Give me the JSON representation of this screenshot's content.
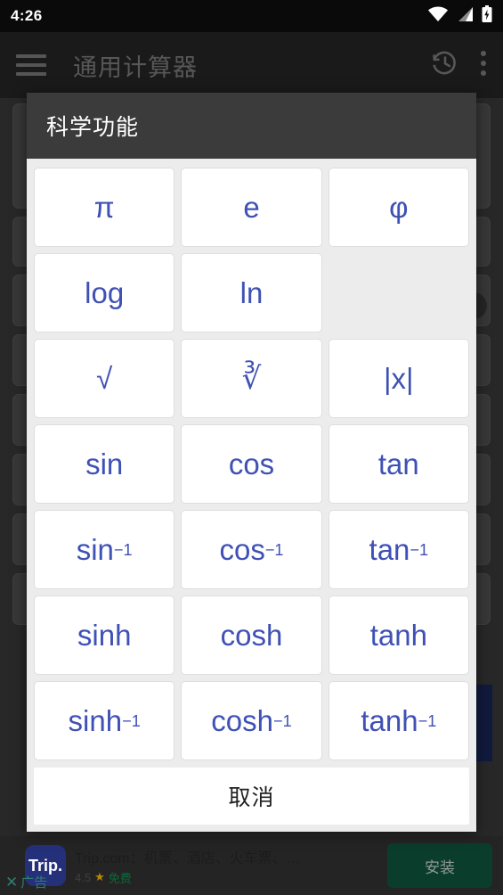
{
  "status_bar": {
    "time": "4:26",
    "icons": [
      "wifi-icon",
      "cellular-signal-icon",
      "battery-charging-icon"
    ]
  },
  "app_bar": {
    "menu_icon": "hamburger-menu-icon",
    "title": "通用计算器",
    "history_icon": "history-clock-icon",
    "overflow_icon": "more-vertical-icon"
  },
  "dialog": {
    "title": "科学功能",
    "buttons": [
      {
        "label": "π",
        "type": "plain"
      },
      {
        "label": "e",
        "type": "plain"
      },
      {
        "label": "φ",
        "type": "plain"
      },
      {
        "label": "log",
        "type": "plain"
      },
      {
        "label": "ln",
        "type": "plain"
      },
      {
        "label": "",
        "type": "empty"
      },
      {
        "label": "√",
        "type": "plain"
      },
      {
        "label": "∛",
        "type": "cbrt"
      },
      {
        "label": "|x|",
        "type": "plain"
      },
      {
        "label": "sin",
        "type": "plain"
      },
      {
        "label": "cos",
        "type": "plain"
      },
      {
        "label": "tan",
        "type": "plain"
      },
      {
        "base": "sin",
        "sup": "−1",
        "type": "sup"
      },
      {
        "base": "cos",
        "sup": "−1",
        "type": "sup"
      },
      {
        "base": "tan",
        "sup": "−1",
        "type": "sup"
      },
      {
        "label": "sinh",
        "type": "plain"
      },
      {
        "label": "cosh",
        "type": "plain"
      },
      {
        "label": "tanh",
        "type": "plain"
      },
      {
        "base": "sinh",
        "sup": "−1",
        "type": "sup"
      },
      {
        "base": "cosh",
        "sup": "−1",
        "type": "sup"
      },
      {
        "base": "tanh",
        "sup": "−1",
        "type": "sup"
      }
    ],
    "cancel_label": "取消",
    "accent_color": "#3f51b5",
    "header_color": "#3b3b3b",
    "body_color": "#ececec"
  },
  "ad": {
    "icon_text": "Trip.",
    "title": "Trip.com：机票、酒店、火车票、…",
    "rating": "4.5",
    "star": "★",
    "price_label": "免费",
    "install_label": "安装",
    "close_x": "✕",
    "ad_label": "广告",
    "install_color": "#0b3d2c"
  }
}
